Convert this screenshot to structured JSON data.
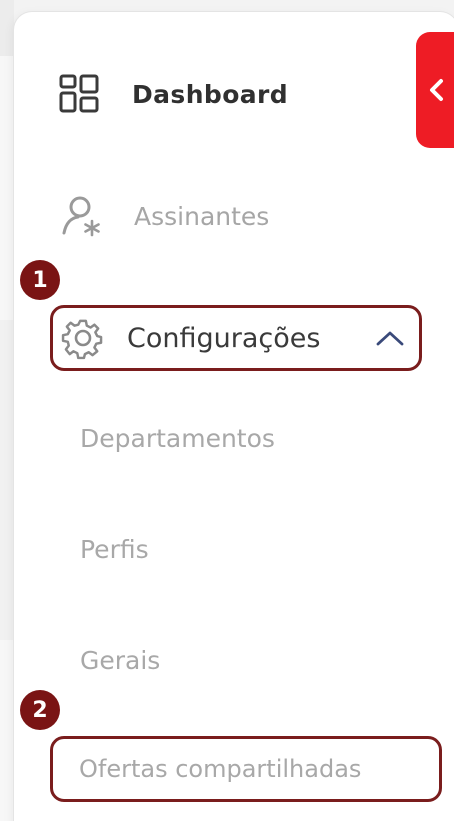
{
  "sidebar": {
    "collapse_icon": "chevron-left-icon",
    "items": [
      {
        "label": "Dashboard",
        "icon": "dashboard-grid-icon"
      },
      {
        "label": "Assinantes",
        "icon": "user-star-icon"
      },
      {
        "label": "Configurações",
        "icon": "gear-icon",
        "expanded_icon": "chevron-up-icon"
      }
    ],
    "submenu": [
      {
        "label": "Departamentos"
      },
      {
        "label": "Perfis"
      },
      {
        "label": "Gerais"
      },
      {
        "label": "Ofertas compartilhadas"
      }
    ]
  },
  "annotations": {
    "step1": "1",
    "step2": "2"
  },
  "colors": {
    "accent_red": "#ee1c25",
    "annotation_dark_red": "#7a1414",
    "text_muted": "#a8a8a8",
    "text_dark": "#333333",
    "chevron_blue": "#3a4a7a"
  }
}
